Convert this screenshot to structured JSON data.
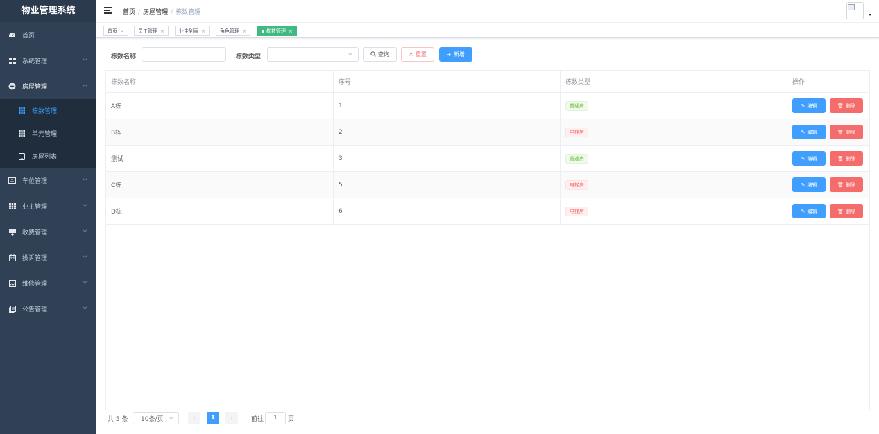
{
  "app": {
    "title": "物业管理系统"
  },
  "sidebar": {
    "items": [
      {
        "label": "首页",
        "icon": "dashboard-icon"
      },
      {
        "label": "系统管理",
        "icon": "grid-icon"
      },
      {
        "label": "房屋管理",
        "icon": "plus-circle-icon"
      },
      {
        "label": "车位管理",
        "icon": "parking-icon"
      },
      {
        "label": "业主管理",
        "icon": "table-icon"
      },
      {
        "label": "收费管理",
        "icon": "money-icon"
      },
      {
        "label": "投诉管理",
        "icon": "calendar-icon"
      },
      {
        "label": "维修管理",
        "icon": "picture-icon"
      },
      {
        "label": "公告管理",
        "icon": "copy-icon"
      }
    ],
    "sub_items": [
      {
        "label": "栋数管理",
        "icon": "building-icon"
      },
      {
        "label": "单元管理",
        "icon": "building-icon"
      },
      {
        "label": "房屋列表",
        "icon": "tablet-icon"
      }
    ]
  },
  "breadcrumb": [
    "首页",
    "房屋管理",
    "栋数管理"
  ],
  "tags": [
    {
      "label": "首页"
    },
    {
      "label": "员工管理"
    },
    {
      "label": "业主列表"
    },
    {
      "label": "角色管理"
    },
    {
      "label": "栋数管理"
    }
  ],
  "search": {
    "name_label": "栋数名称",
    "name_value": "",
    "type_label": "栋数类型",
    "type_value": "",
    "query_label": "查询",
    "reset_label": "重置",
    "add_label": "新增"
  },
  "table": {
    "headers": [
      "栋数名称",
      "序号",
      "栋数类型",
      "操作"
    ],
    "rows": [
      {
        "name": "A栋",
        "order": "1",
        "type": "普通房",
        "type_kind": "normal"
      },
      {
        "name": "B栋",
        "order": "2",
        "type": "电梯房",
        "type_kind": "elevator"
      },
      {
        "name": "测试",
        "order": "3",
        "type": "普通房",
        "type_kind": "normal"
      },
      {
        "name": "C栋",
        "order": "5",
        "type": "电梯房",
        "type_kind": "elevator"
      },
      {
        "name": "D栋",
        "order": "6",
        "type": "电梯房",
        "type_kind": "elevator"
      }
    ],
    "edit_label": "编辑",
    "delete_label": "删除"
  },
  "pagination": {
    "total_text": "共 5 条",
    "page_size": "10条/页",
    "current_page": "1",
    "goto_prefix": "前往",
    "goto_value": "1",
    "goto_suffix": "页"
  },
  "colors": {
    "sidebar_bg": "#304156",
    "active_tag": "#42b983",
    "primary": "#409eff",
    "danger": "#f56c6c",
    "success_tag": "#67c23a"
  }
}
